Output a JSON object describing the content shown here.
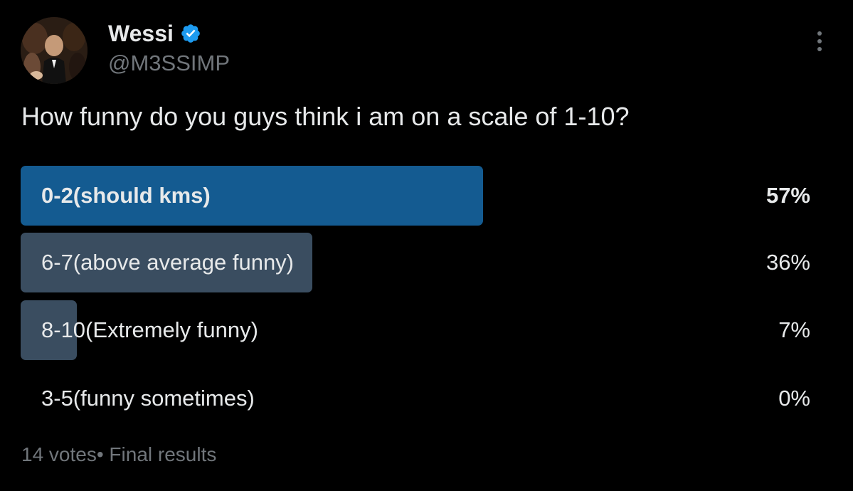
{
  "author": {
    "display_name": "Wessi",
    "handle": "@M3SSIMP",
    "verified": true,
    "avatar_icon": "user-avatar-photo",
    "verified_icon": "verified-badge-icon"
  },
  "tweet": {
    "text": "How funny do you guys think i am on a scale of 1-10?"
  },
  "poll": {
    "options": [
      {
        "label": "0-2(should kms)",
        "percent_text": "57%",
        "percent": 57,
        "winner": true
      },
      {
        "label": "6-7(above average funny)",
        "percent_text": "36%",
        "percent": 36,
        "winner": false
      },
      {
        "label": "8-10(Extremely funny)",
        "percent_text": "7%",
        "percent": 7,
        "winner": false
      },
      {
        "label": "3-5(funny sometimes)",
        "percent_text": "0%",
        "percent": 0,
        "winner": false
      }
    ],
    "footer": "14 votes• Final results"
  },
  "colors": {
    "background": "#000000",
    "text_primary": "#e7e9ea",
    "text_secondary": "#71767b",
    "winner_bar": "#145b91",
    "other_bar": "#3a4d60",
    "verified_blue": "#1d9bf0"
  },
  "icons": {
    "more": "more-options-icon"
  }
}
